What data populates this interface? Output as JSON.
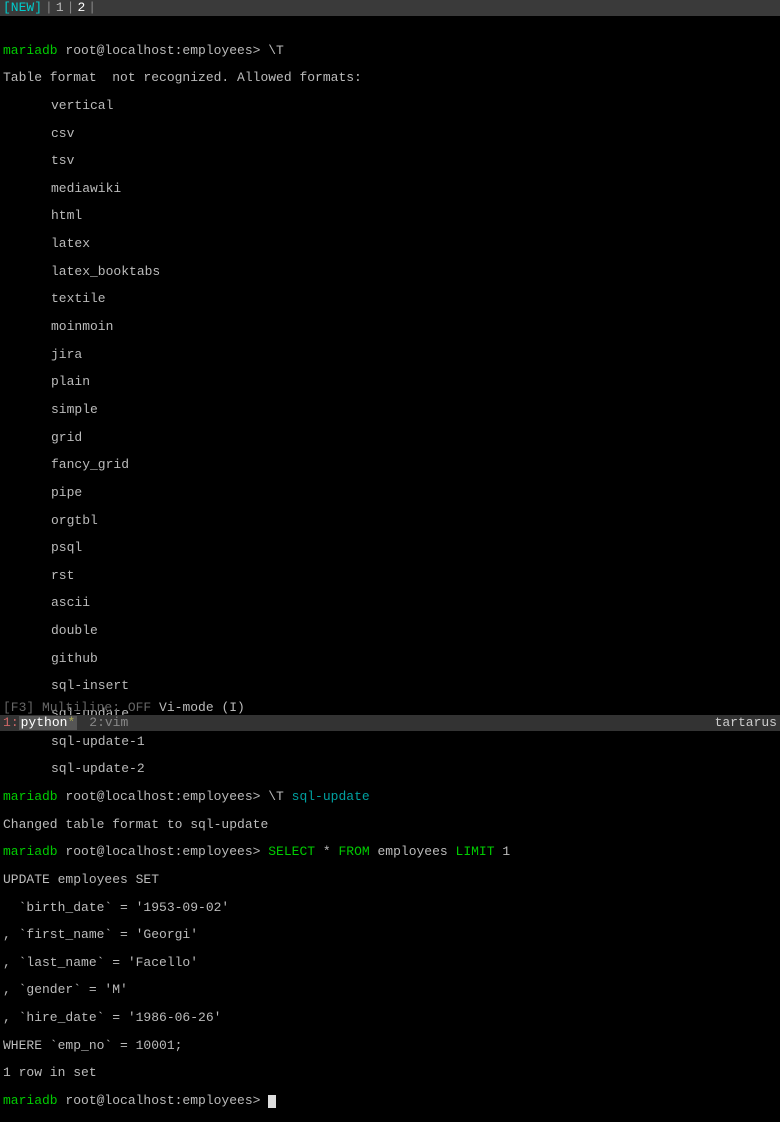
{
  "top_tabs": {
    "new_label": "[NEW]",
    "sep": "|",
    "tab1": "1",
    "tab2": "2"
  },
  "prompt": {
    "db": "mariadb",
    "user_host": " root@localhost:employees> "
  },
  "cmd1": "\\T",
  "error_header": "Table format  not recognized. Allowed formats:",
  "formats": [
    "vertical",
    "csv",
    "tsv",
    "mediawiki",
    "html",
    "latex",
    "latex_booktabs",
    "textile",
    "moinmoin",
    "jira",
    "plain",
    "simple",
    "grid",
    "fancy_grid",
    "pipe",
    "orgtbl",
    "psql",
    "rst",
    "ascii",
    "double",
    "github",
    "sql-insert",
    "sql-update",
    "sql-update-1",
    "sql-update-2"
  ],
  "cmd2_prefix": "\\T ",
  "cmd2_arg": "sql-update",
  "changed_msg": "Changed table format to sql-update",
  "sql": {
    "select": "SELECT",
    "star": " * ",
    "from": "FROM",
    "employees": " employees ",
    "limit": "LIMIT",
    "one": " 1"
  },
  "result": [
    "UPDATE employees SET",
    "  `birth_date` = '1953-09-02'",
    ", `first_name` = 'Georgi'",
    ", `last_name` = 'Facello'",
    ", `gender` = 'M'",
    ", `hire_date` = '1986-06-26'",
    "WHERE `emp_no` = 10001;",
    "1 row in set"
  ],
  "status": {
    "faded": "[F3] Multiline: OFF",
    "vi": "  Vi-mode (I)"
  },
  "bottom": {
    "idx1": "1",
    "sep": ":",
    "name1": "python",
    "star": "*",
    "idx2": "2",
    "name2": "vim",
    "host": "tartarus"
  }
}
